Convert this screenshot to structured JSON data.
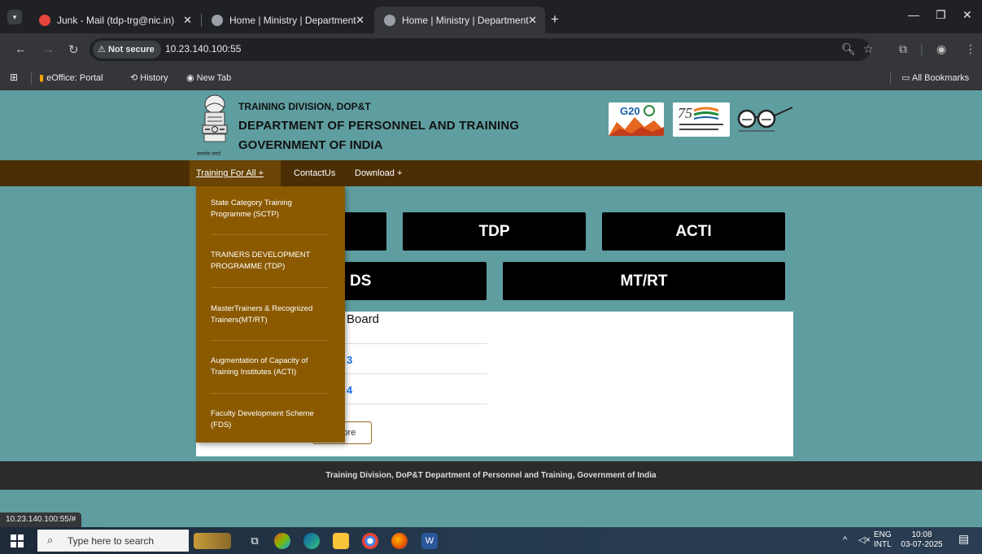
{
  "browser": {
    "tabs": [
      {
        "title": "Junk - Mail (tdp-trg@nic.in)",
        "favicon": "mail-icon",
        "active": false
      },
      {
        "title": "Home | Ministry | Department |",
        "favicon": "globe-icon",
        "active": false
      },
      {
        "title": "Home | Ministry | Department |",
        "favicon": "globe-icon",
        "active": true
      }
    ],
    "security_label": "Not secure",
    "url": "10.23.140.100:55",
    "bookmarks": [
      "eOffice: Portal",
      "History",
      "New Tab"
    ],
    "all_bookmarks_label": "All Bookmarks",
    "status_url": "10.23.140.100:55/#"
  },
  "header": {
    "line1": "TRAINING DIVISION, DOP&T",
    "line2": "DEPARTMENT OF PERSONNEL AND TRAINING",
    "line3": "GOVERNMENT OF INDIA",
    "emblem_caption": "सत्यमेव जयते",
    "logos": [
      "G20",
      "Azadi Ka Amrit Mahotsav",
      "Swachh Bharat"
    ]
  },
  "nav": {
    "items": [
      "Training For All +",
      "ContactUs",
      "Download +"
    ]
  },
  "dropdown": {
    "items": [
      "State Category Training Programme (SCTP)",
      "TRAINERS DEVELOPMENT PROGRAMME (TDP)",
      "MasterTrainers & Recognized Trainers(MT/RT)",
      "Augmentation of Capacity of Training Institutes (ACTI)",
      "Faculty Development Scheme (FDS)"
    ]
  },
  "tiles": {
    "tdp": "TDP",
    "acti": "ACTI",
    "fds_partial": "DS",
    "mtrt": "MT/RT"
  },
  "board": {
    "title_partial": "Board",
    "link1_partial": "3",
    "link2_partial": "4",
    "more_partial": "lore"
  },
  "footer": {
    "text": "Training Division, DoP&T Department of Personnel and Training, Government of India"
  },
  "taskbar": {
    "search_placeholder": "Type here to search",
    "lang_top": "ENG",
    "lang_bottom": "INTL",
    "time": "10:08",
    "date": "03-07-2025"
  },
  "colors": {
    "page_bg": "#5f9ea0",
    "nav_bg": "#4b2e05",
    "dropdown_bg": "#8b5a00",
    "tile_bg": "#000000",
    "footer_bg": "#2b2b2b"
  }
}
